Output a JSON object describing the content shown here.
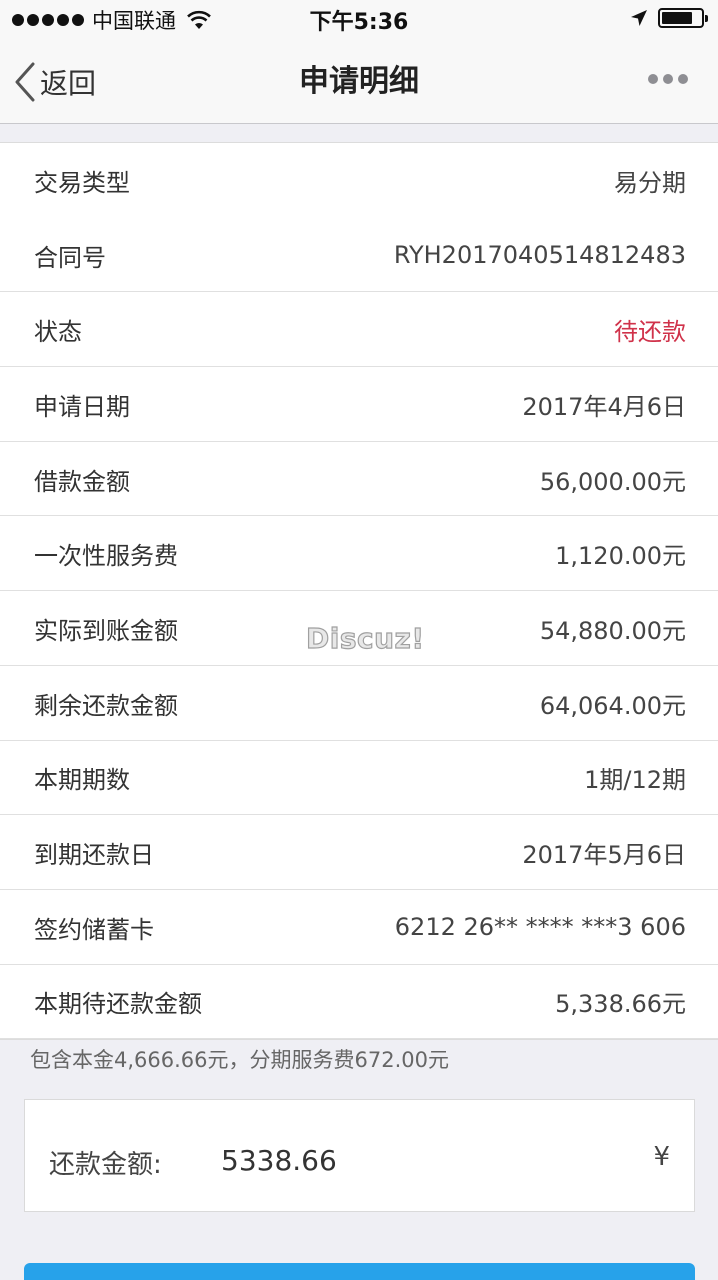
{
  "status_bar": {
    "carrier": "中国联通",
    "time": "下午5:36",
    "battery_level": 0.8
  },
  "nav": {
    "back_label": "返回",
    "title": "申请明细"
  },
  "details": [
    {
      "label": "交易类型",
      "value": "易分期"
    },
    {
      "label": "合同号",
      "value": "RYH2017040514812483"
    },
    {
      "label": "状态",
      "value": "待还款"
    },
    {
      "label": "申请日期",
      "value": "2017年4月6日"
    },
    {
      "label": "借款金额",
      "value": "56,000.00元"
    },
    {
      "label": "一次性服务费",
      "value": "1,120.00元"
    },
    {
      "label": "实际到账金额",
      "value": "54,880.00元"
    },
    {
      "label": "剩余还款金额",
      "value": "64,064.00元"
    },
    {
      "label": "本期期数",
      "value": "1期/12期"
    },
    {
      "label": "到期还款日",
      "value": "2017年5月6日"
    },
    {
      "label": "签约储蓄卡",
      "value": "6212 26** **** ***3 606"
    },
    {
      "label": "本期待还款金额",
      "value": "5,338.66元"
    }
  ],
  "status_color": "#d0324a",
  "watermark": "Discuz!",
  "note": "包含本金4,666.66元，分期服务费672.00元",
  "payment": {
    "label": "还款金额:",
    "amount": "5338.66",
    "currency": "¥"
  },
  "button_color": "#27a2ea"
}
